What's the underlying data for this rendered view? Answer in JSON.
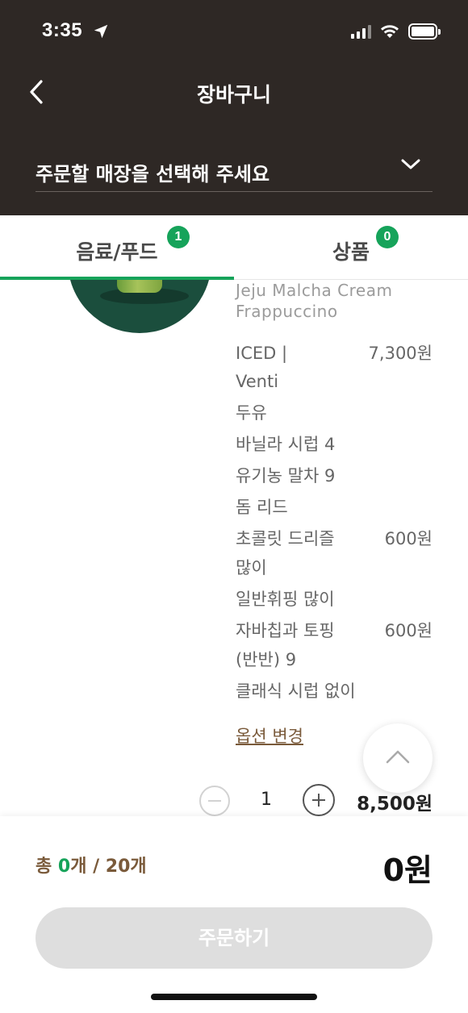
{
  "status_bar": {
    "time": "3:35"
  },
  "header": {
    "title": "장바구니",
    "store_placeholder": "주문할 매장을 선택해 주세요"
  },
  "tabs": [
    {
      "label": "음료/푸드",
      "badge": "1",
      "selected": true
    },
    {
      "label": "상품",
      "badge": "0",
      "selected": false
    }
  ],
  "item": {
    "name_en_line1": "Jeju Malcha Cream",
    "name_en_line2": "Frappuccino",
    "options": [
      {
        "text": "ICED |",
        "price": "7,300원"
      },
      {
        "text": "Venti",
        "price": ""
      },
      {
        "text": "두유",
        "price": ""
      },
      {
        "text": "바닐라 시럽 4",
        "price": ""
      },
      {
        "text": "유기농 말차 9",
        "price": ""
      },
      {
        "text": "돔 리드",
        "price": ""
      },
      {
        "text": "초콜릿 드리즐",
        "price": "600원"
      },
      {
        "text": "많이",
        "price": ""
      },
      {
        "text": "일반휘핑 많이",
        "price": ""
      },
      {
        "text": "자바칩과 토핑",
        "price": "600원"
      },
      {
        "text": "(반반) 9",
        "price": ""
      },
      {
        "text": "클래식 시럽 없이",
        "price": ""
      }
    ],
    "change_option_label": "옵션 변경",
    "quantity": "1",
    "line_total": "8,500원"
  },
  "footer": {
    "count_prefix": "총 ",
    "count_value": "0",
    "count_suffix": "개 / 20개",
    "total_price": "0원",
    "order_button": "주문하기"
  },
  "colors": {
    "header_bg": "#2e2825",
    "accent_green": "#16a35a",
    "brown_text": "#7a5a3a",
    "disabled_button": "#dedede"
  },
  "icons": [
    "location-arrow-icon",
    "signal-icon",
    "wifi-icon",
    "battery-icon",
    "back-chevron-icon",
    "chevron-down-icon",
    "minus-icon",
    "plus-icon",
    "chevron-up-icon"
  ]
}
